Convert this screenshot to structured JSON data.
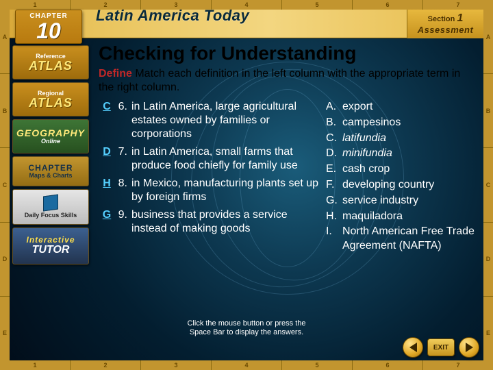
{
  "chapter": {
    "label": "CHAPTER",
    "number": "10"
  },
  "banner_title": "Latin America Today",
  "section": {
    "line1_prefix": "Section",
    "number": "1",
    "line2": "Assessment"
  },
  "ruler_top": [
    "1",
    "2",
    "3",
    "4",
    "5",
    "6",
    "7"
  ],
  "ruler_bottom": [
    "1",
    "2",
    "3",
    "4",
    "5",
    "6",
    "7"
  ],
  "ruler_left": [
    "A",
    "B",
    "C",
    "D",
    "E"
  ],
  "ruler_right": [
    "A",
    "B",
    "C",
    "D",
    "E"
  ],
  "sidebar": {
    "ref_atlas": {
      "line1": "Reference",
      "line2": "ATLAS"
    },
    "reg_atlas": {
      "line1": "Regional",
      "line2": "ATLAS"
    },
    "geo": {
      "line1": "GEOGRAPHY",
      "line2": "Online"
    },
    "chapter": {
      "line1": "CHAPTER",
      "line2": "Maps & Charts"
    },
    "dfs": {
      "line1": "Daily",
      "line2": "Focus",
      "line3": "Skills"
    },
    "tutor": {
      "line1": "Interactive",
      "line2": "TUTOR"
    }
  },
  "content": {
    "heading": "Checking for Understanding",
    "define_label": "Define",
    "instruction": " Match each definition in the left column with the appropriate term in the right column.",
    "definitions": [
      {
        "answer": "C",
        "num": "6.",
        "text": "in Latin America, large agricultural estates owned by families or corporations"
      },
      {
        "answer": "D",
        "num": "7.",
        "text": "in Latin America, small farms that produce food chiefly for family use"
      },
      {
        "answer": "H",
        "num": "8.",
        "text": "in Mexico, manufacturing plants set up by foreign firms"
      },
      {
        "answer": "G",
        "num": "9.",
        "text": "business that provides a service instead of making goods"
      }
    ],
    "terms": [
      {
        "letter": "A.",
        "term": "export",
        "italic": false
      },
      {
        "letter": "B.",
        "term": "campesinos",
        "italic": false
      },
      {
        "letter": "C.",
        "term": "latifundia",
        "italic": true
      },
      {
        "letter": "D.",
        "term": "minifundia",
        "italic": true
      },
      {
        "letter": "E.",
        "term": "cash crop",
        "italic": false
      },
      {
        "letter": "F.",
        "term": "developing country",
        "italic": false
      },
      {
        "letter": "G.",
        "term": "service industry",
        "italic": false
      },
      {
        "letter": "H.",
        "term": "maquiladora",
        "italic": false
      },
      {
        "letter": "I.",
        "term": "North American Free Trade Agreement (NAFTA)",
        "italic": false
      }
    ]
  },
  "footer_hint": {
    "l1": "Click the mouse button or press the",
    "l2": "Space Bar to display the answers."
  },
  "nav": {
    "exit": "EXIT"
  }
}
